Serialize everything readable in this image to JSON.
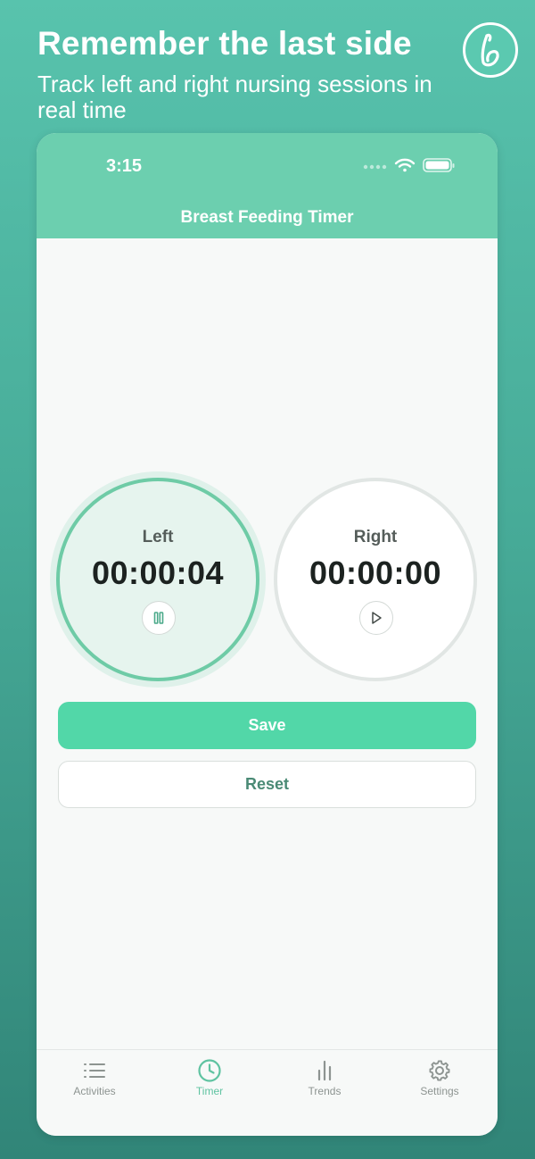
{
  "promo": {
    "title": "Remember the last side",
    "subtitle": "Track left and right nursing sessions in real time"
  },
  "status_bar": {
    "time": "3:15"
  },
  "nav": {
    "title": "Breast Feeding Timer"
  },
  "timers": [
    {
      "label": "Left",
      "value": "00:00:04",
      "state": "running",
      "control_icon": "pause-icon"
    },
    {
      "label": "Right",
      "value": "00:00:00",
      "state": "stopped",
      "control_icon": "play-icon"
    }
  ],
  "actions": {
    "save_label": "Save",
    "reset_label": "Reset"
  },
  "tabs": [
    {
      "label": "Activities",
      "icon": "list-icon",
      "active": false
    },
    {
      "label": "Timer",
      "icon": "clock-icon",
      "active": true
    },
    {
      "label": "Trends",
      "icon": "bar-chart-icon",
      "active": false
    },
    {
      "label": "Settings",
      "icon": "gear-icon",
      "active": false
    }
  ],
  "colors": {
    "accent": "#52d7a8",
    "header": "#6ccfaf",
    "active_tab": "#5fc3a1",
    "background_top": "#58c3ad",
    "background_bottom": "#318578"
  }
}
